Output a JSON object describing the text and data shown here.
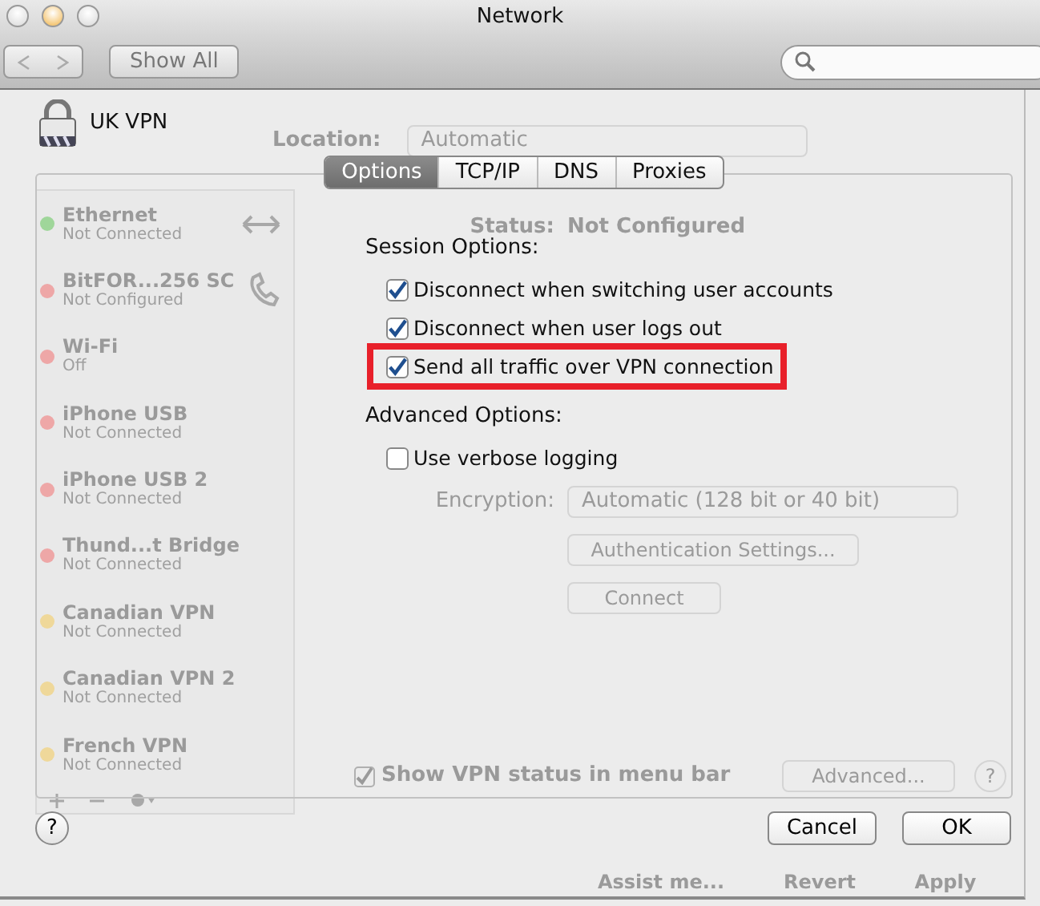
{
  "window": {
    "title": "Network"
  },
  "toolbar": {
    "show_all": "Show All"
  },
  "location": {
    "label": "Location:",
    "value": "Automatic"
  },
  "services": [
    {
      "name": "Ethernet",
      "status": "Not Connected",
      "color": "#9fd69a",
      "kind": "ethernet"
    },
    {
      "name": "BitFOR...256 SC",
      "status": "Not Configured",
      "color": "#eea7a7",
      "kind": "phone"
    },
    {
      "name": "Wi-Fi",
      "status": "Off",
      "color": "#eea7a7",
      "kind": "plain"
    },
    {
      "name": "iPhone USB",
      "status": "Not Connected",
      "color": "#eea7a7",
      "kind": "plain"
    },
    {
      "name": "iPhone USB 2",
      "status": "Not Connected",
      "color": "#eea7a7",
      "kind": "plain"
    },
    {
      "name": "Thund...t Bridge",
      "status": "Not Connected",
      "color": "#eea7a7",
      "kind": "plain"
    },
    {
      "name": "Canadian VPN",
      "status": "Not Connected",
      "color": "#efd89a",
      "kind": "plain"
    },
    {
      "name": "Canadian VPN 2",
      "status": "Not Connected",
      "color": "#efd89a",
      "kind": "plain"
    },
    {
      "name": "French VPN",
      "status": "Not Connected",
      "color": "#efd89a",
      "kind": "plain"
    }
  ],
  "detail": {
    "status_label": "Status:",
    "status_value": "Not Configured",
    "encryption_label": "Encryption:",
    "encryption_value": "Automatic (128 bit or 40 bit)",
    "buttons": [
      "Authentication Settings...",
      "Connect"
    ],
    "show_status": {
      "label": "Show VPN status in menu bar",
      "checked": true
    },
    "advanced": "Advanced...",
    "help": "?"
  },
  "footer_buttons": [
    "Assist me...",
    "Revert",
    "Apply"
  ],
  "sheet": {
    "service": "UK VPN",
    "tabs": [
      {
        "label": "Options",
        "selected": true
      },
      {
        "label": "TCP/IP",
        "selected": false
      },
      {
        "label": "DNS",
        "selected": false
      },
      {
        "label": "Proxies",
        "selected": false
      }
    ],
    "sections": [
      {
        "title": "Session Options:",
        "options": [
          {
            "label": "Disconnect when switching user accounts",
            "checked": true
          },
          {
            "label": "Disconnect when user logs out",
            "checked": true
          },
          {
            "label": "Send all traffic over VPN connection",
            "checked": true,
            "highlighted": true
          }
        ]
      },
      {
        "title": "Advanced Options:",
        "options": [
          {
            "label": "Use verbose logging",
            "checked": false
          }
        ]
      }
    ],
    "help": "?",
    "buttons": [
      "Cancel",
      "OK"
    ]
  }
}
